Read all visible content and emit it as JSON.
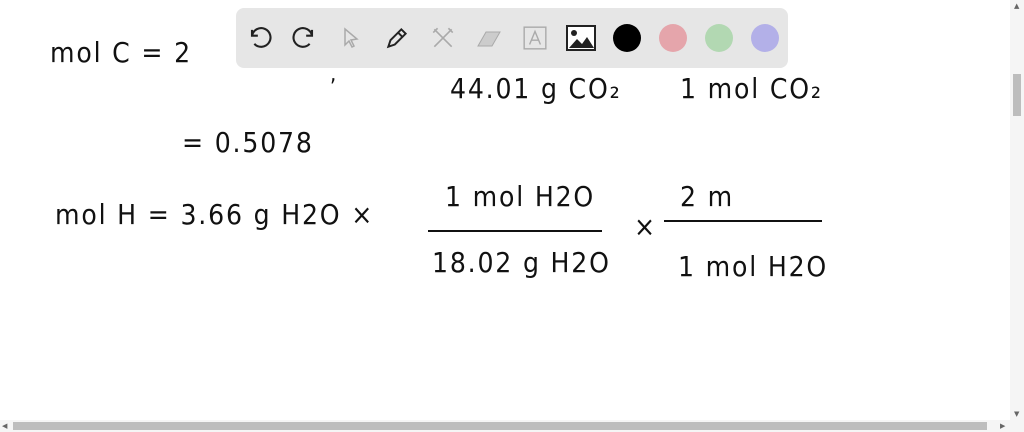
{
  "toolbar": {
    "tools": [
      "undo-icon",
      "redo-icon",
      "select-icon",
      "pen-icon",
      "tools-icon",
      "eraser-icon",
      "text-icon",
      "image-icon"
    ],
    "colors": [
      "#000000",
      "#e5a5ab",
      "#b2d8b2",
      "#b3b0e8"
    ]
  },
  "board": {
    "line1_left": "mol C = 2",
    "line1_den1": "44.01 g CO₂",
    "line1_den2": "1 mol CO₂",
    "line2": "= 0.5078",
    "line3_left": "mol H = 3.66 g H2O ×",
    "frac1_num": "1 mol H2O",
    "frac1_den": "18.02 g H2O",
    "times": "×",
    "frac2_num": "2 m",
    "frac2_den": "1 mol H2O"
  }
}
